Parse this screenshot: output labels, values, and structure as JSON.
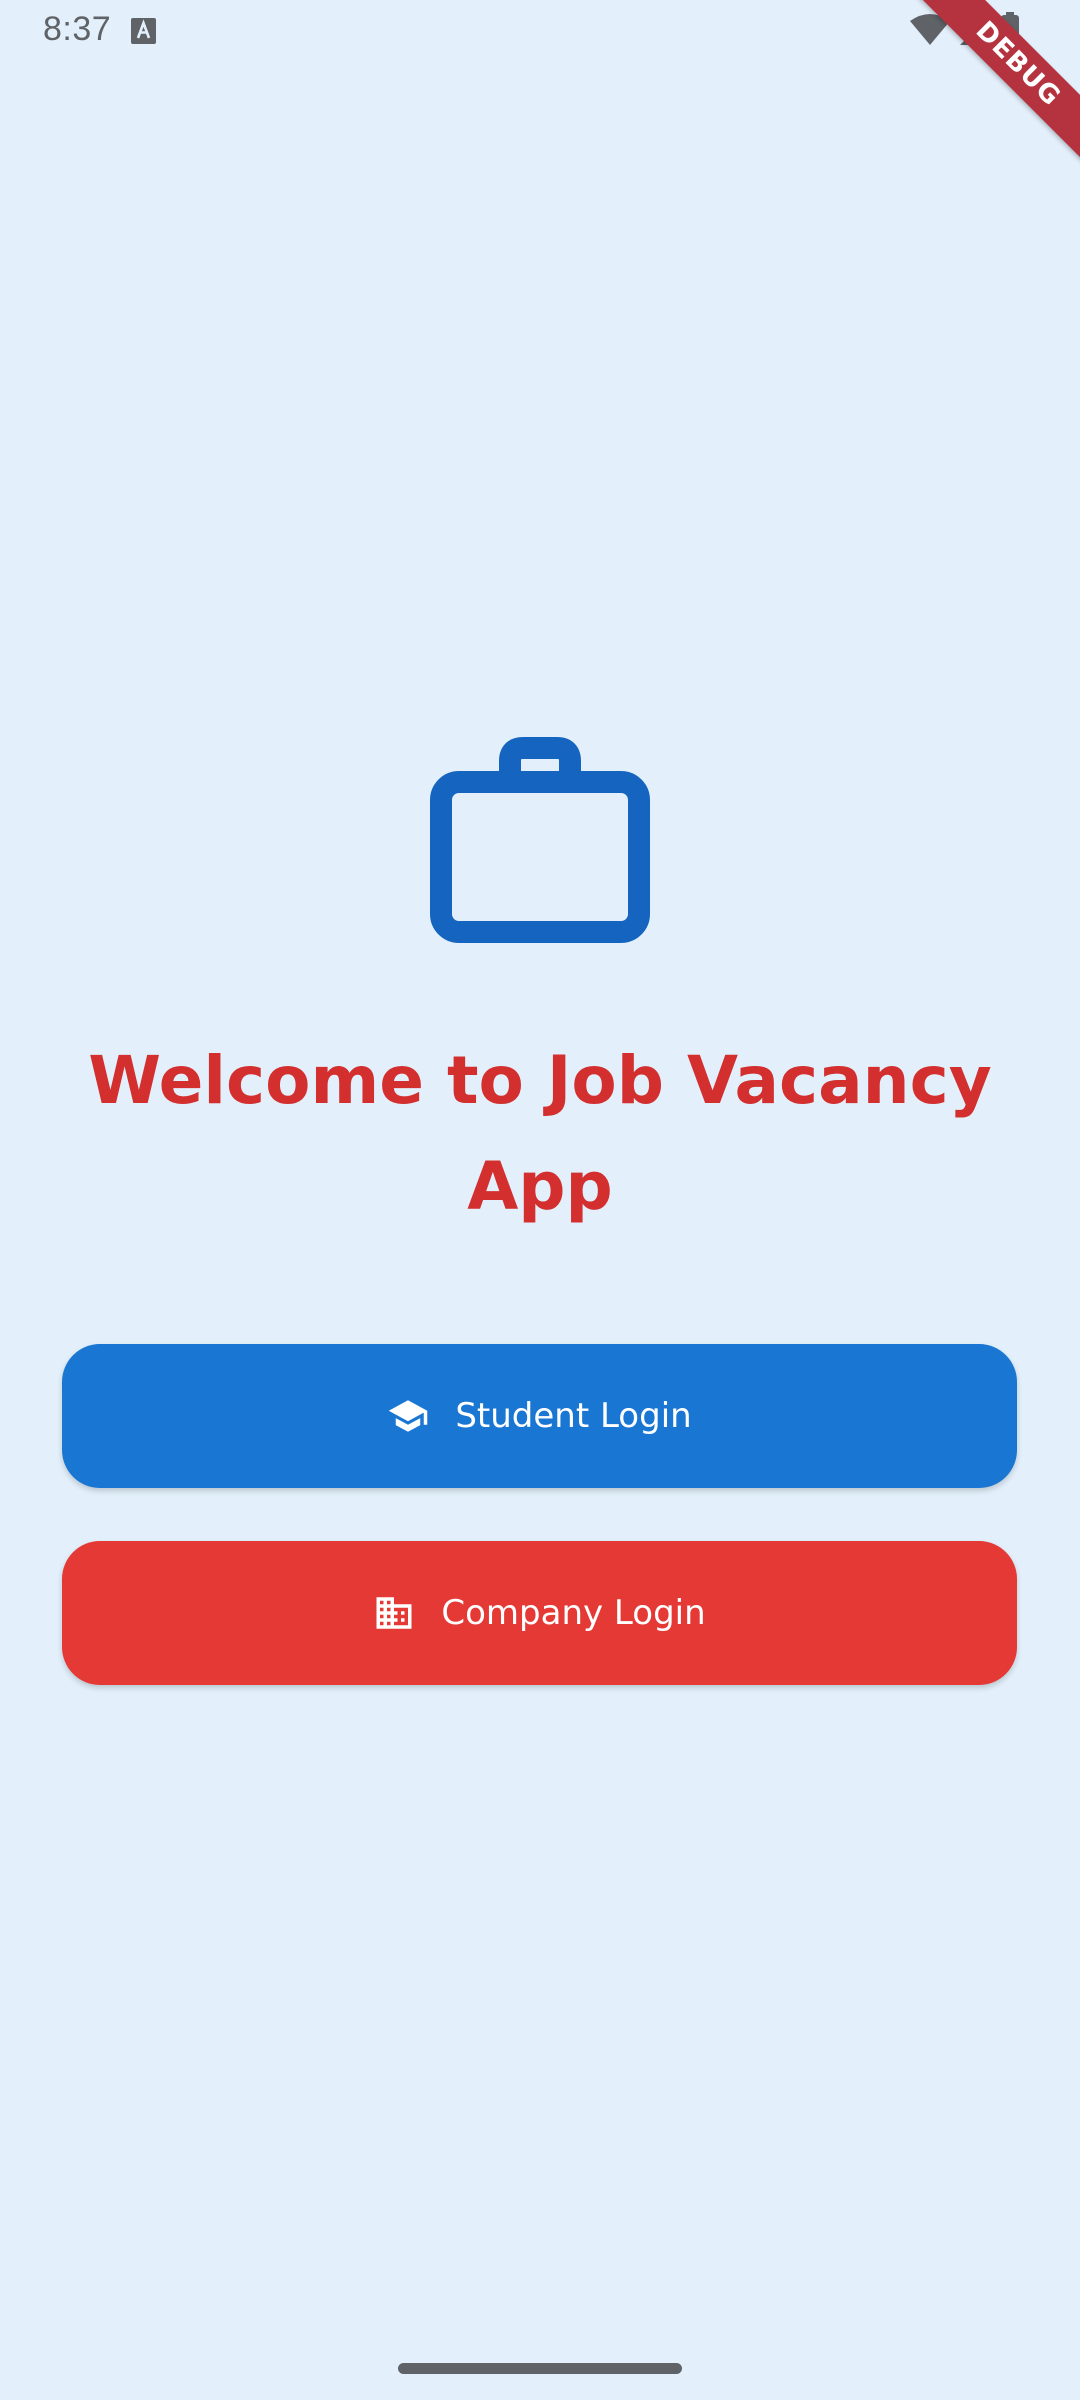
{
  "status_bar": {
    "time": "8:37",
    "icons": [
      "keyboard-a-icon",
      "wifi-icon",
      "cellular-signal-icon",
      "battery-icon"
    ]
  },
  "debug_banner": {
    "label": "DEBUG"
  },
  "main": {
    "logo_icon": "briefcase-icon",
    "title": "Welcome to Job Vacancy App",
    "buttons": [
      {
        "label": "Student Login",
        "icon": "graduation-cap-icon",
        "color": "#1976d2"
      },
      {
        "label": "Company Login",
        "icon": "business-building-icon",
        "color": "#e53935"
      }
    ]
  },
  "colors": {
    "background": "#e3f0fb",
    "title": "#d32f2f",
    "icon": "#1565c0"
  }
}
